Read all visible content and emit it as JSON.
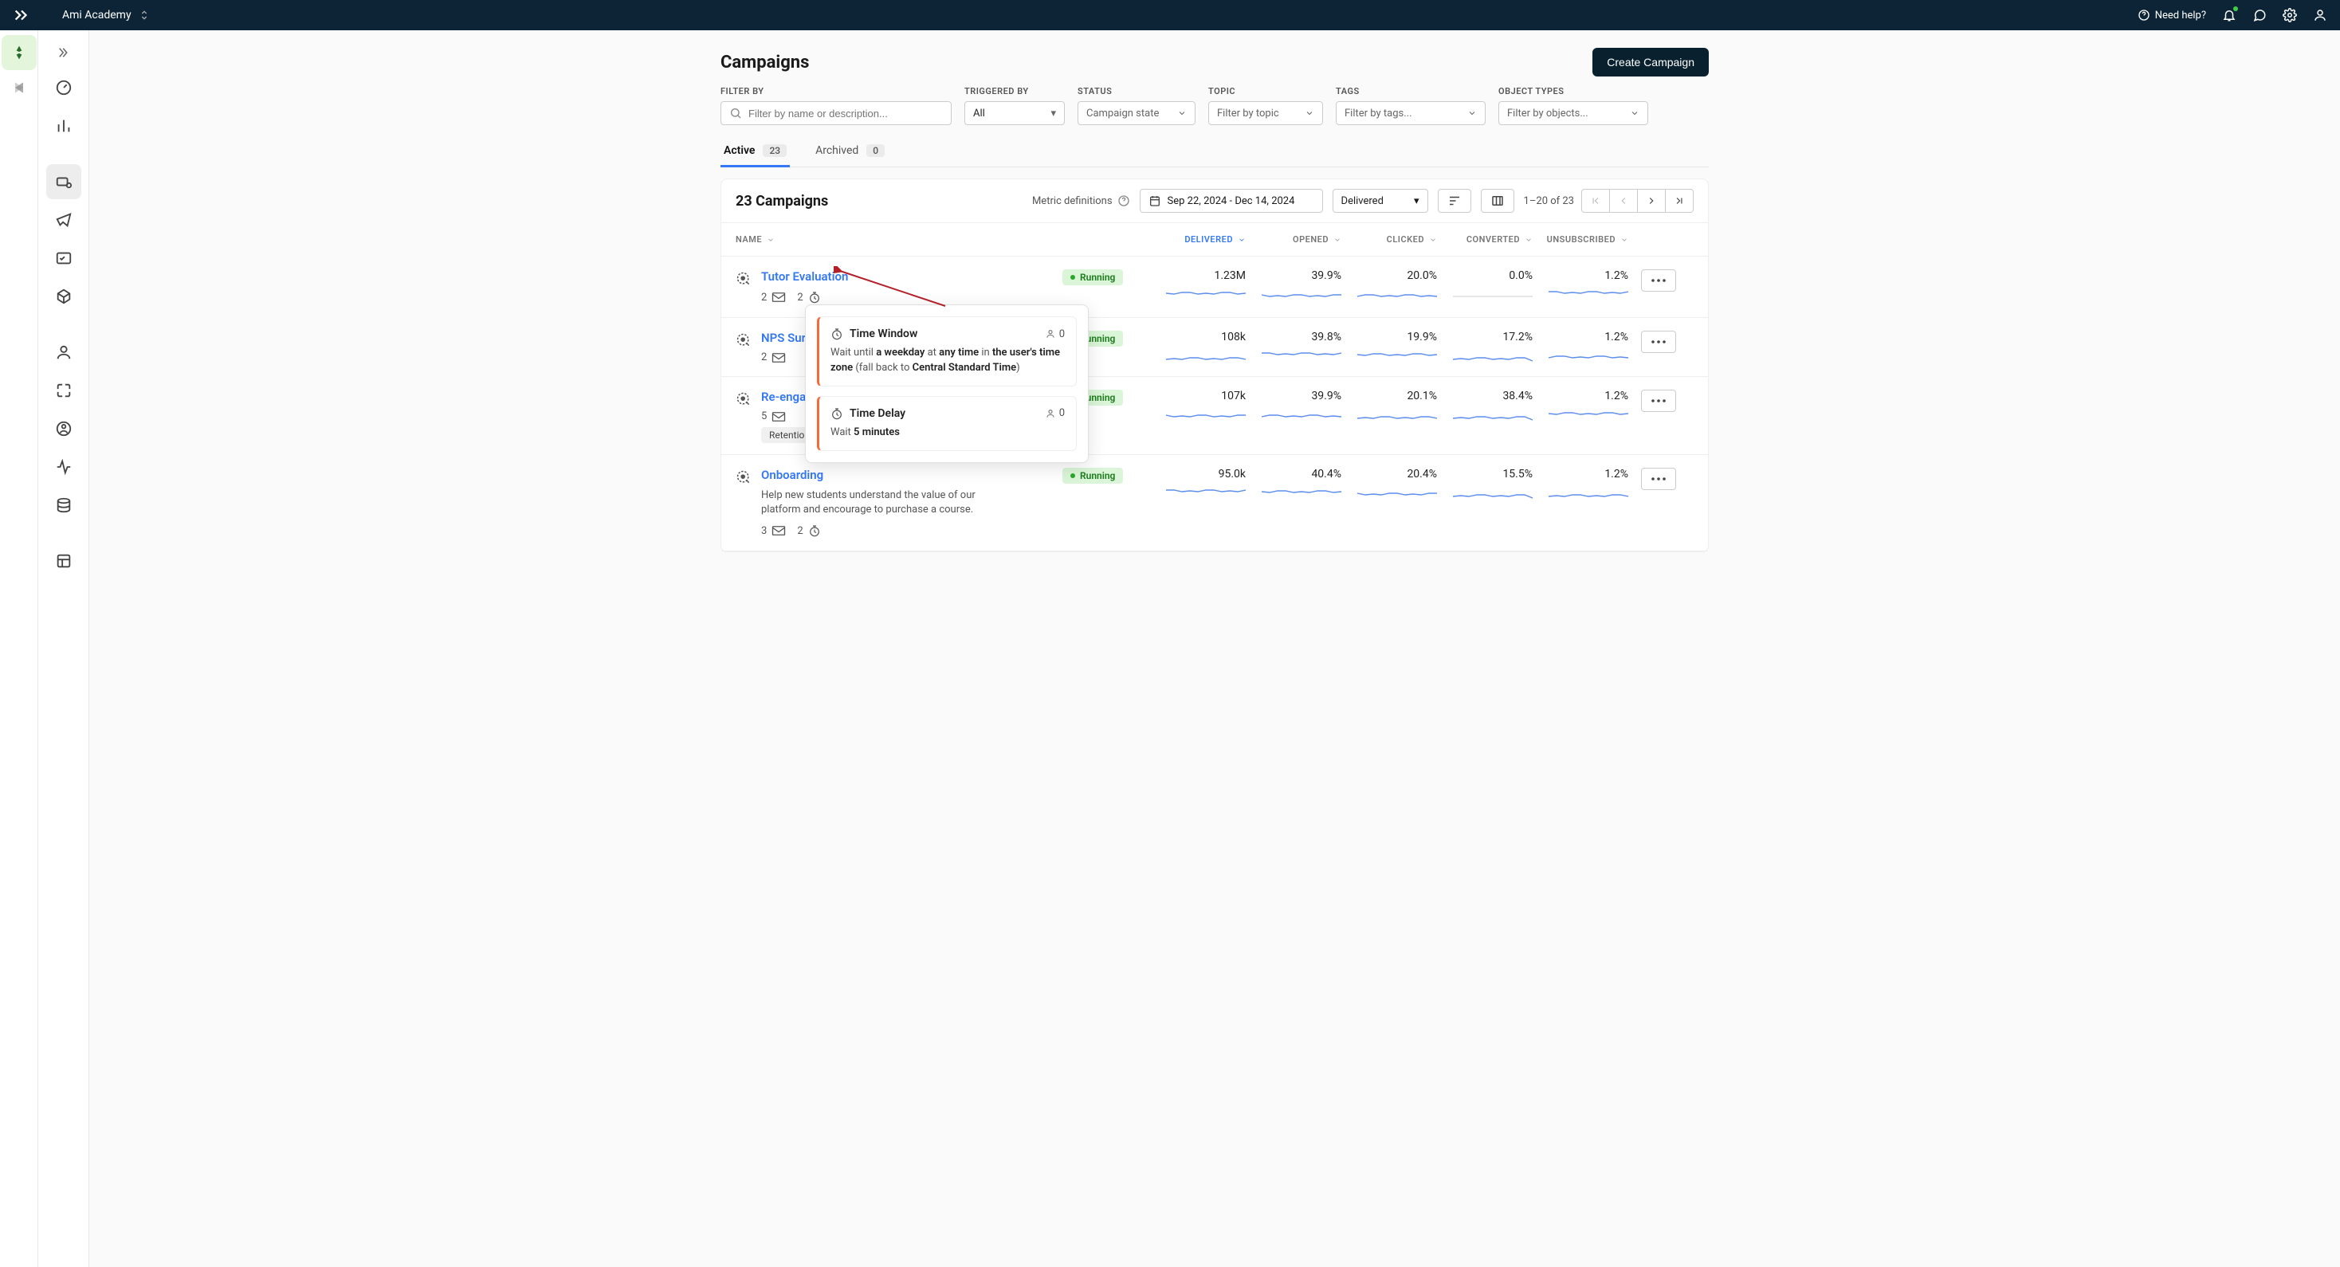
{
  "header": {
    "workspace": "Ami Academy",
    "help": "Need help?"
  },
  "page": {
    "title": "Campaigns",
    "createBtn": "Create Campaign"
  },
  "filters": {
    "filterByLabel": "FILTER BY",
    "filterByPlaceholder": "Filter by name or description...",
    "triggeredByLabel": "TRIGGERED BY",
    "triggeredByValue": "All",
    "statusLabel": "STATUS",
    "statusPlaceholder": "Campaign state",
    "topicLabel": "TOPIC",
    "topicPlaceholder": "Filter by topic",
    "tagsLabel": "TAGS",
    "tagsPlaceholder": "Filter by tags...",
    "objectTypesLabel": "OBJECT TYPES",
    "objectTypesPlaceholder": "Filter by objects..."
  },
  "tabs": {
    "active": {
      "label": "Active",
      "count": "23"
    },
    "archived": {
      "label": "Archived",
      "count": "0"
    }
  },
  "toolbar": {
    "title": "23 Campaigns",
    "metricDefs": "Metric definitions",
    "dateRange": "Sep 22, 2024 - Dec 14, 2024",
    "metricSelect": "Delivered",
    "pagerInfo": "1–20 of 23"
  },
  "columns": {
    "name": "NAME",
    "delivered": "DELIVERED",
    "opened": "OPENED",
    "clicked": "CLICKED",
    "converted": "CONVERTED",
    "unsubscribed": "UNSUBSCRIBED"
  },
  "rows": [
    {
      "title": "Tutor Evaluation",
      "desc": "",
      "msgCount": "2",
      "delayCount": "2",
      "tags": [],
      "status": "Running",
      "delivered": "1.23M",
      "opened": "39.9%",
      "clicked": "20.0%",
      "converted": "0.0%",
      "unsubscribed": "1.2%"
    },
    {
      "title": "NPS Sur",
      "desc": "",
      "msgCount": "2",
      "delayCount": "",
      "tags": [],
      "status": "Running",
      "delivered": "108k",
      "opened": "39.8%",
      "clicked": "19.9%",
      "converted": "17.2%",
      "unsubscribed": "1.2%"
    },
    {
      "title": "Re-enga",
      "desc": "",
      "msgCount": "5",
      "delayCount": "",
      "tags": [
        "Retention"
      ],
      "status": "Running",
      "delivered": "107k",
      "opened": "39.9%",
      "clicked": "20.1%",
      "converted": "38.4%",
      "unsubscribed": "1.2%"
    },
    {
      "title": "Onboarding",
      "desc": "Help new students understand the value of our platform and encourage to purchase a course.",
      "msgCount": "3",
      "delayCount": "2",
      "tags": [],
      "status": "Running",
      "delivered": "95.0k",
      "opened": "40.4%",
      "clicked": "20.4%",
      "converted": "15.5%",
      "unsubscribed": "1.2%"
    }
  ],
  "popover": {
    "card1": {
      "title": "Time Window",
      "count": "0",
      "prefix": "Wait until ",
      "b1": "a weekday",
      "mid1": " at ",
      "b2": "any time",
      "mid2": " in ",
      "b3": "the user's time zone",
      "mid3": " (fall back to ",
      "b4": "Central Standard Time",
      "suffix": ")"
    },
    "card2": {
      "title": "Time Delay",
      "count": "0",
      "prefix": "Wait ",
      "b1": "5 minutes"
    }
  }
}
